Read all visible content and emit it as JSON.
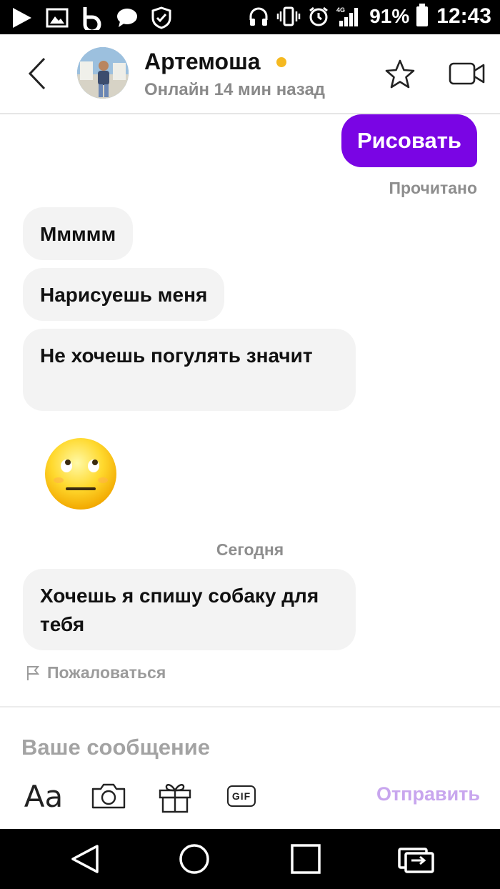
{
  "status_bar": {
    "battery": "91%",
    "time": "12:43",
    "network": "4G"
  },
  "header": {
    "contact_name": "Артемоша",
    "online_status": "Онлайн 14 мин назад",
    "online_color": "#f5b921"
  },
  "messages": {
    "outgoing": [
      {
        "text": "Рисовать"
      }
    ],
    "read_receipt": "Прочитано",
    "incoming": [
      {
        "text": "Ммммм"
      },
      {
        "text": "Нарисуешь меня"
      },
      {
        "text": "Не хочешь погулять значит"
      }
    ],
    "emoji": "neutral-face-emoji",
    "date_separator": "Сегодня",
    "incoming_today": [
      {
        "text": "Хочешь я спишу собаку для тебя"
      }
    ],
    "report_label": "Пожаловаться"
  },
  "composer": {
    "placeholder": "Ваше сообщение",
    "font_button": "Aa",
    "gif_button": "GIF",
    "send_label": "Отправить"
  },
  "colors": {
    "accent_purple": "#7a05e4",
    "send_disabled": "#c8a6ee",
    "bubble_in": "#f3f3f3"
  }
}
